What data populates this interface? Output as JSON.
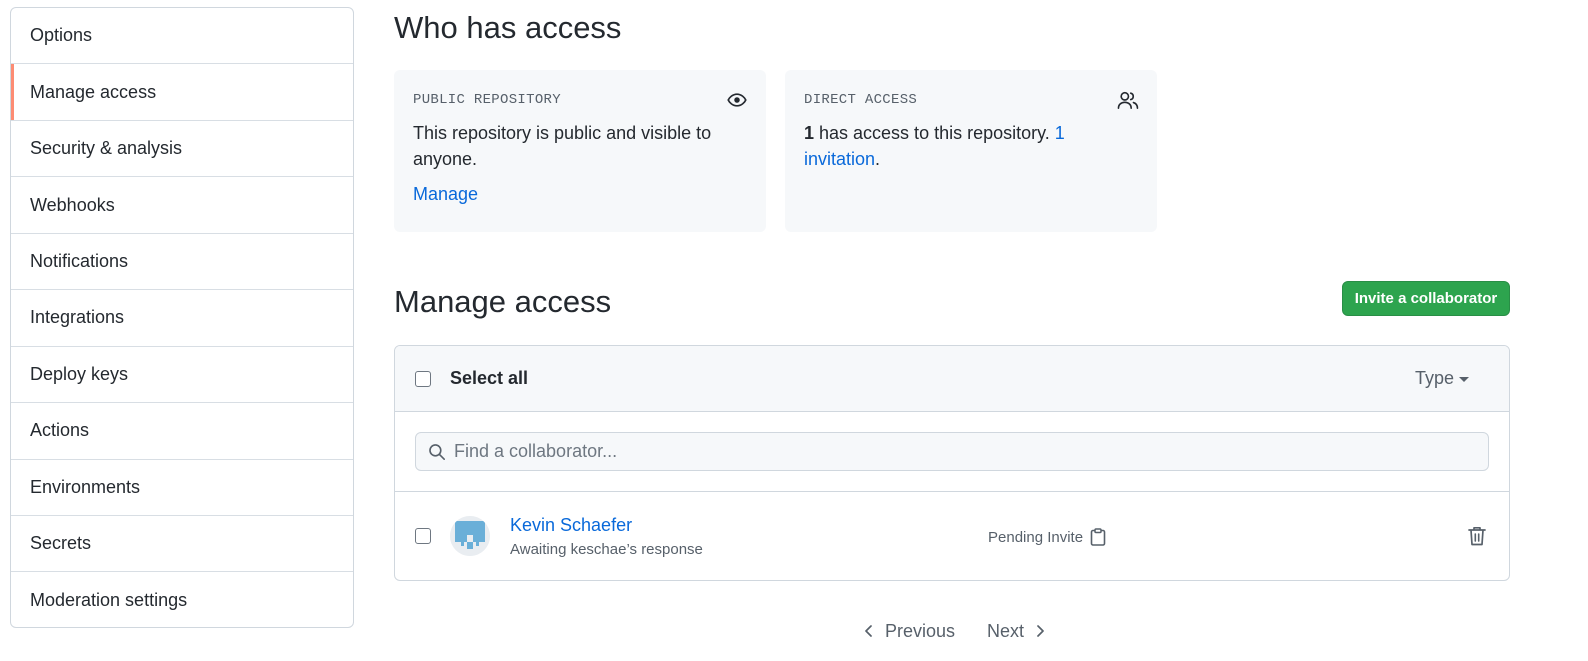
{
  "sidebar": {
    "items": [
      {
        "label": "Options"
      },
      {
        "label": "Manage access",
        "selected": true
      },
      {
        "label": "Security & analysis"
      },
      {
        "label": "Webhooks"
      },
      {
        "label": "Notifications"
      },
      {
        "label": "Integrations"
      },
      {
        "label": "Deploy keys"
      },
      {
        "label": "Actions"
      },
      {
        "label": "Environments"
      },
      {
        "label": "Secrets"
      },
      {
        "label": "Moderation settings"
      }
    ]
  },
  "who_has_access": {
    "title": "Who has access",
    "public_card": {
      "label": "PUBLIC REPOSITORY",
      "icon": "eye-icon",
      "text": "This repository is public and visible to anyone.",
      "link": "Manage"
    },
    "direct_card": {
      "label": "DIRECT ACCESS",
      "icon": "people-icon",
      "count": "1",
      "text": " has access to this repository. ",
      "invitation_link": "1 invitation",
      "suffix": "."
    }
  },
  "manage_access": {
    "title": "Manage access",
    "invite_button": "Invite a collaborator",
    "select_all": "Select all",
    "type_filter": "Type",
    "search_placeholder": "Find a collaborator...",
    "collaborators": [
      {
        "name": "Kevin Schaefer",
        "status": "Awaiting keschae’s response",
        "badge": "Pending Invite"
      }
    ]
  },
  "pagination": {
    "previous": "Previous",
    "next": "Next"
  },
  "colors": {
    "accent_link": "#0969da",
    "invite_green": "#2da44e",
    "selected_marker": "#fd8c73"
  }
}
